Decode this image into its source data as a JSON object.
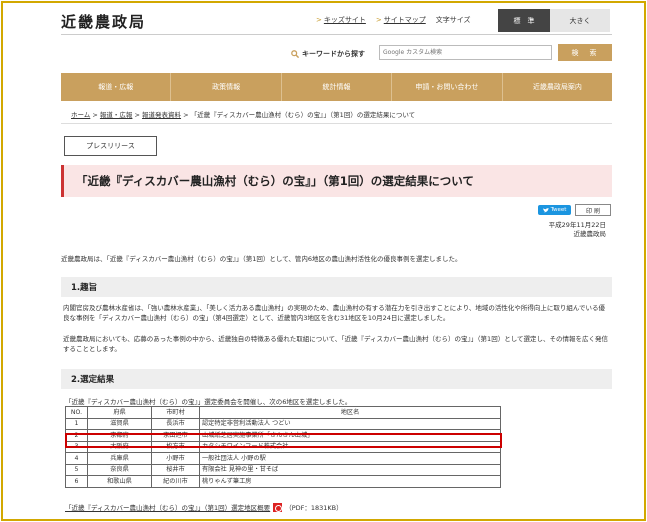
{
  "header": {
    "logo": "近畿農政局",
    "kids_link": "キッズサイト",
    "sitemap_link": "サイトマップ",
    "font_size_label": "文字サイズ",
    "font_standard": "標　準",
    "font_large": "大きく"
  },
  "search": {
    "label": "キーワードから探す",
    "placeholder": "Google カスタム検索",
    "button": "検　索"
  },
  "nav": {
    "items": [
      "報道・広報",
      "政策情報",
      "統計情報",
      "申請・お問い合わせ",
      "近畿農政局案内"
    ]
  },
  "breadcrumb": {
    "home": "ホーム",
    "sep": ">",
    "koho": "報道・広報",
    "release": "報道発表資料",
    "current": "「近畿『ディスカバー農山漁村（むら）の宝』」（第1回）の選定結果について"
  },
  "press_release_button": "プレスリリース",
  "page_title": "「近畿『ディスカバー農山漁村（むら）の宝』」（第1回）の選定結果について",
  "share": {
    "tweet": "Tweet",
    "print": "印 刷"
  },
  "date": "平成29年11月22日",
  "issuer": "近畿農政局",
  "intro": "近畿農政局は、「近畿『ディスカバー農山漁村（むら）の宝』」（第1回）として、管内6地区の農山漁村活性化の優良事例を選定しました。",
  "section1": {
    "heading": "1.趣旨",
    "para1": "内閣官房及び農林水産省は、「強い農林水産業」、「美しく活力ある農山漁村」の実現のため、農山漁村の有する潜在力を引き出すことにより、地域の活性化や所得向上に取り組んでいる優良な事例を「ディスカバー農山漁村（むら）の宝」（第4回選定）として、近畿管内3地区を含む31地区を10月24日に選定しました。",
    "para2": "近畿農政局においても、応募のあった事例の中から、近畿独自の特徴ある優れた取組について、「近畿『ディスカバー農山漁村（むら）の宝』」（第1回）として選定し、その情報を広く発信することとします。"
  },
  "section2": {
    "heading": "2.選定結果",
    "table_intro": "「近畿『ディスカバー農山漁村（むら）の宝』」選定委員会を開催し、次の6地区を選定しました。",
    "headers": [
      "NO.",
      "府県",
      "市町村",
      "地区名"
    ],
    "rows": [
      [
        "1",
        "滋賀県",
        "長浜市",
        "認定特定非営利活動法人 つどい"
      ],
      [
        "2",
        "京都府",
        "京田辺市",
        "山城紙芝居実施事業所「さんさん山城」"
      ],
      [
        "3",
        "大阪府",
        "枚方市",
        "カタシモワインフード株式会社"
      ],
      [
        "4",
        "兵庫県",
        "小野市",
        "一般社団法人 小野の駅"
      ],
      [
        "5",
        "奈良県",
        "桜井市",
        "有限会社 見神の里・甘そば"
      ],
      [
        "6",
        "和歌山県",
        "紀の川市",
        "桃りゃんず筆工房"
      ]
    ],
    "highlighted_row": 2
  },
  "footnote": {
    "link": "「近畿『ディスカバー農山漁村（むら）の宝』」（第1回）選定地区概要",
    "size": "（PDF：1831KB）"
  },
  "colors": {
    "gold": "#c9a05e",
    "highlight_red": "#cc0000",
    "frame": "#d2a800"
  }
}
